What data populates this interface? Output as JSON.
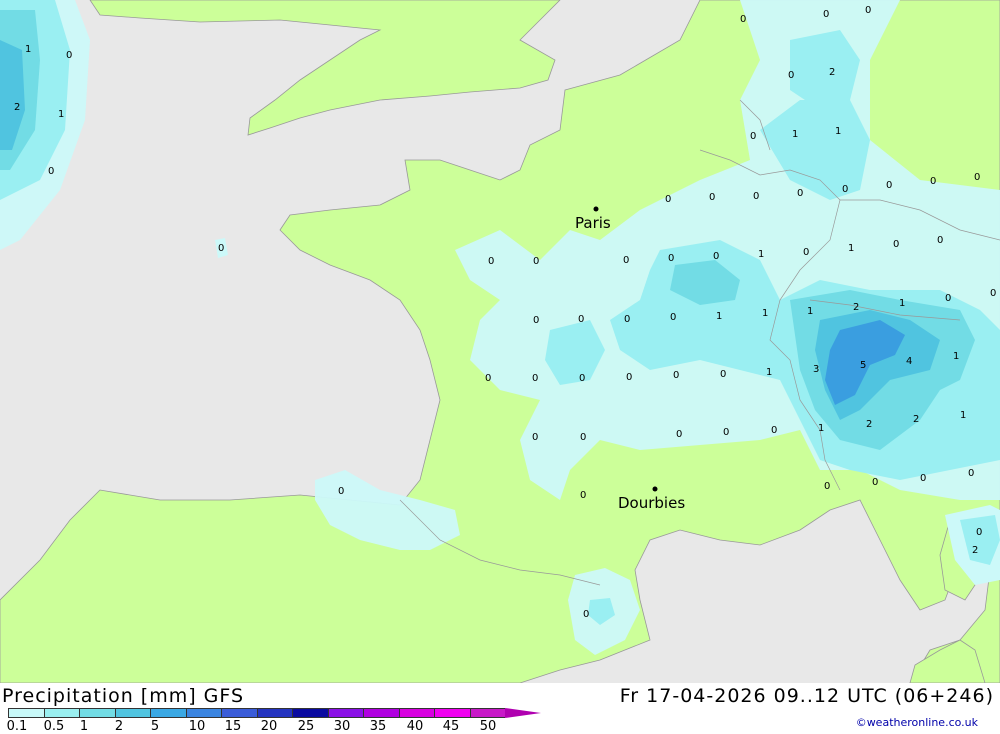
{
  "map": {
    "colors": {
      "sea": "#e8e8e8",
      "land": "#ccff99",
      "precip_0": "#ccf9f9",
      "precip_05": "#9aeff2",
      "precip_1": "#72dce5",
      "precip_2": "#50c4e0",
      "precip_5": "#3a9ee0",
      "border": "#999999"
    },
    "cities": [
      {
        "name": "Paris"
      },
      {
        "name": "Dourbies"
      }
    ],
    "values": [
      "0",
      "1",
      "2",
      "1",
      "0",
      "0",
      "0",
      "2",
      "0",
      "1",
      "1",
      "0",
      "0",
      "0",
      "0",
      "0",
      "0",
      "0",
      "0",
      "0",
      "0",
      "0",
      "0",
      "0",
      "0",
      "0",
      "0",
      "1",
      "0",
      "1",
      "0",
      "0",
      "0",
      "0",
      "0",
      "0",
      "0",
      "0",
      "1",
      "1",
      "1",
      "2",
      "1",
      "0",
      "0",
      "0",
      "0",
      "0",
      "0",
      "0",
      "0",
      "1",
      "3",
      "5",
      "4",
      "1",
      "0",
      "0",
      "0",
      "0",
      "0",
      "0",
      "1",
      "2",
      "2",
      "1",
      "0",
      "0",
      "0",
      "0",
      "0",
      "0",
      "2",
      "0"
    ]
  },
  "legend": {
    "title": "Precipitation [mm] GFS",
    "datetime": "Fr 17-04-2026 09..12 UTC (06+246)",
    "credit": "©weatheronline.co.uk",
    "scale_colors": [
      "#c8f8f8",
      "#9aeff0",
      "#72dce5",
      "#50c4e0",
      "#3aa8e4",
      "#3a84e0",
      "#3a5cd8",
      "#2434c0",
      "#0a0aa0",
      "#8a10e6",
      "#b000e0",
      "#d800e0",
      "#f000f0",
      "#c818c8"
    ],
    "tick_labels": [
      "0.1",
      "0.5",
      "1",
      "2",
      "5",
      "10",
      "15",
      "20",
      "25",
      "30",
      "35",
      "40",
      "45",
      "50"
    ]
  }
}
